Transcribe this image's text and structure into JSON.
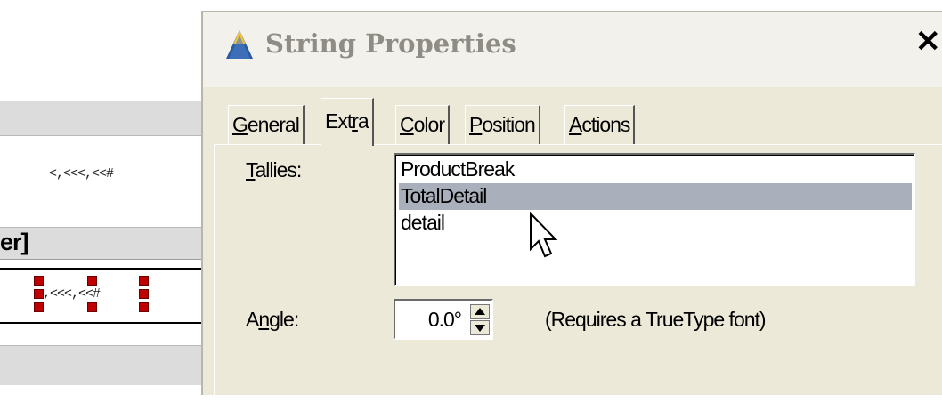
{
  "background": {
    "field_top": "<,<<<,<<#",
    "band_label": "er]",
    "field_bottom": "<,<<<,<<#"
  },
  "dialog": {
    "title": "String Properties",
    "close_glyph": "✕",
    "tabs": [
      {
        "pre": "",
        "u": "G",
        "post": "eneral"
      },
      {
        "pre": "Ext",
        "u": "r",
        "post": "a"
      },
      {
        "pre": "",
        "u": "C",
        "post": "olor"
      },
      {
        "pre": "",
        "u": "P",
        "post": "osition"
      },
      {
        "pre": "",
        "u": "A",
        "post": "ctions"
      }
    ],
    "active_tab": "Extra",
    "tallies": {
      "label_u": "T",
      "label_rest": "allies:",
      "items": [
        "ProductBreak",
        "TotalDetail",
        "detail"
      ],
      "selected": "TotalDetail"
    },
    "angle": {
      "label_pre": "A",
      "label_u": "n",
      "label_post": "gle:",
      "value": "0.0°",
      "note": "(Requires a TrueType font)"
    }
  },
  "icons": {
    "app": "triangle-app-icon",
    "up": "spin-up-icon",
    "down": "spin-down-icon",
    "cursor": "mouse-cursor-icon"
  },
  "colors": {
    "selection": "#aab0bb",
    "dialog_bg": "#ece9d8",
    "handle": "#c00000"
  }
}
